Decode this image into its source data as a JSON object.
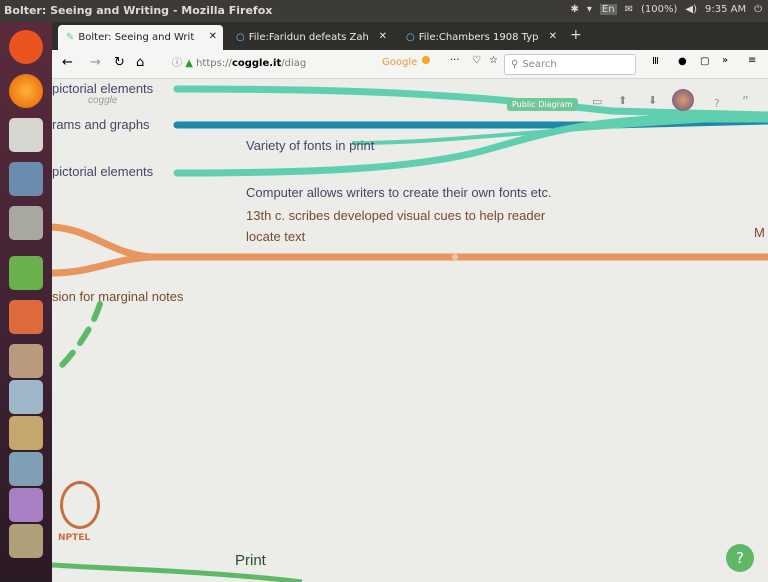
{
  "window": {
    "title": "Bolter: Seeing and Writing - Mozilla Firefox"
  },
  "tray": {
    "lang": "En",
    "battery": "(100%)",
    "time": "9:35 AM"
  },
  "tabs": [
    {
      "label": "Bolter: Seeing and Writ"
    },
    {
      "label": "File:Faridun defeats Zah"
    },
    {
      "label": "File:Chambers 1908 Typ"
    }
  ],
  "navbar": {
    "url_prefix": "https://",
    "url_domain": "coggle.it",
    "url_rest": "/diag",
    "search_engine": "Google",
    "search_placeholder": "Search"
  },
  "toolbar": {
    "badge": "Public Diagram",
    "zoom_text": "?"
  },
  "nodes": {
    "pictorial_top": "pictorial elements",
    "coggle_mark": "coggle",
    "diagrams": "rams and graphs",
    "variety_fonts": "Variety of fonts in print",
    "pictorial_mid": "pictorial elements",
    "computer_fonts": "Computer allows writers to create their own fonts etc.",
    "scribes_line1": "13th c. scribes developed visual cues to help reader",
    "scribes_line2": "locate text",
    "right_letter": "M",
    "marginal": "sion for marginal notes",
    "print": "Print"
  },
  "nptel": "NPTEL",
  "help": "?",
  "colors": {
    "teal": "#5fcfb0",
    "blue": "#1d88a8",
    "orange": "#e8955e",
    "green": "#5fb866",
    "text_dark": "#45456a",
    "text_brown": "#7a4a2e",
    "text_green_dark": "#2e4a2e"
  }
}
